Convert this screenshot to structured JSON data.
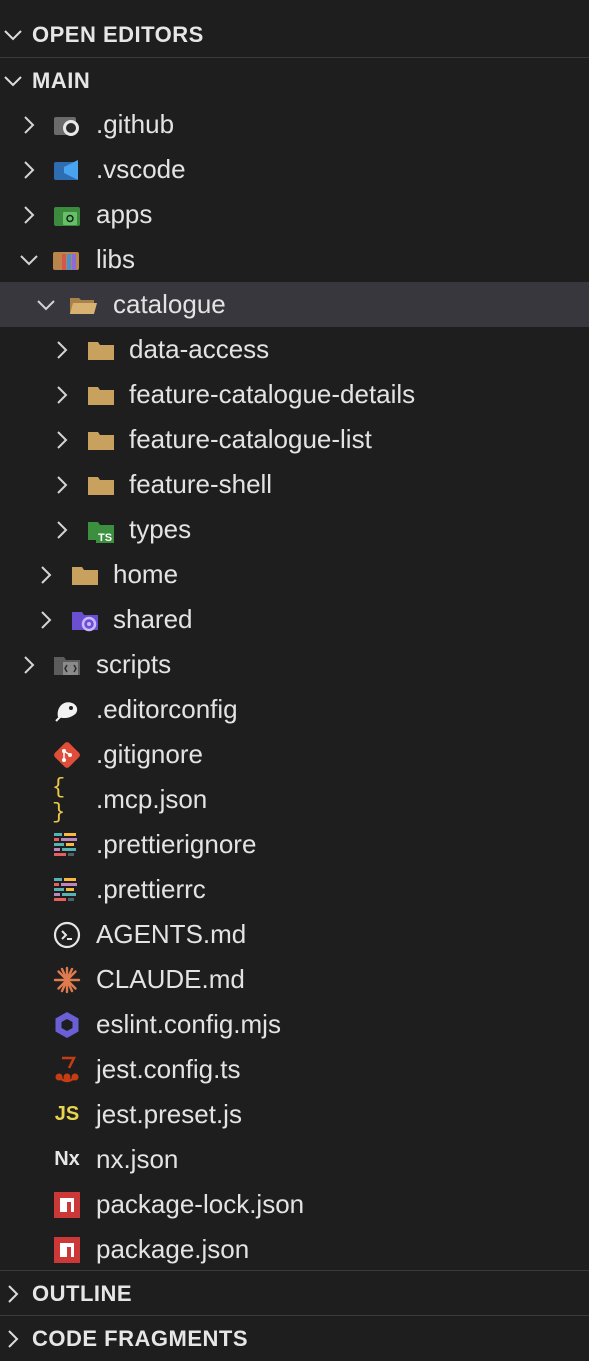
{
  "sections": {
    "open_editors": "OPEN EDITORS",
    "main": "MAIN",
    "outline": "OUTLINE",
    "code_fragments": "CODE FRAGMENTS"
  },
  "tree": [
    {
      "label": ".github",
      "icon": "github-folder-icon"
    },
    {
      "label": ".vscode",
      "icon": "vscode-folder-icon"
    },
    {
      "label": "apps",
      "icon": "apps-folder-icon"
    },
    {
      "label": "libs",
      "icon": "libs-folder-open-icon"
    },
    {
      "label": "catalogue",
      "icon": "folder-open-icon"
    },
    {
      "label": "data-access",
      "icon": "folder-icon"
    },
    {
      "label": "feature-catalogue-details",
      "icon": "folder-icon"
    },
    {
      "label": "feature-catalogue-list",
      "icon": "folder-icon"
    },
    {
      "label": "feature-shell",
      "icon": "folder-icon"
    },
    {
      "label": "types",
      "icon": "typescript-folder-icon"
    },
    {
      "label": "home",
      "icon": "folder-icon"
    },
    {
      "label": "shared",
      "icon": "shared-folder-icon"
    },
    {
      "label": "scripts",
      "icon": "scripts-folder-icon"
    },
    {
      "label": ".editorconfig",
      "icon": "editorconfig-icon"
    },
    {
      "label": ".gitignore",
      "icon": "git-icon"
    },
    {
      "label": ".mcp.json",
      "icon": "json-braces-icon",
      "glyph": "{ }"
    },
    {
      "label": ".prettierignore",
      "icon": "prettier-icon"
    },
    {
      "label": ".prettierrc",
      "icon": "prettier-icon"
    },
    {
      "label": "AGENTS.md",
      "icon": "agents-icon"
    },
    {
      "label": "CLAUDE.md",
      "icon": "claude-icon"
    },
    {
      "label": "eslint.config.mjs",
      "icon": "eslint-icon"
    },
    {
      "label": "jest.config.ts",
      "icon": "jest-icon"
    },
    {
      "label": "jest.preset.js",
      "icon": "javascript-icon",
      "glyph": "JS"
    },
    {
      "label": "nx.json",
      "icon": "nx-icon",
      "glyph": "Nx"
    },
    {
      "label": "package-lock.json",
      "icon": "npm-icon"
    },
    {
      "label": "package.json",
      "icon": "npm-icon"
    }
  ],
  "colors": {
    "background": "#1e1e1f",
    "selected_row": "#37373d",
    "text": "#e3e3e3",
    "folder": "#c8a15e",
    "npm_red": "#cb3837",
    "git_red": "#e04e39",
    "js_yellow": "#e8d44d",
    "eslint_purple": "#6b5fd6"
  }
}
